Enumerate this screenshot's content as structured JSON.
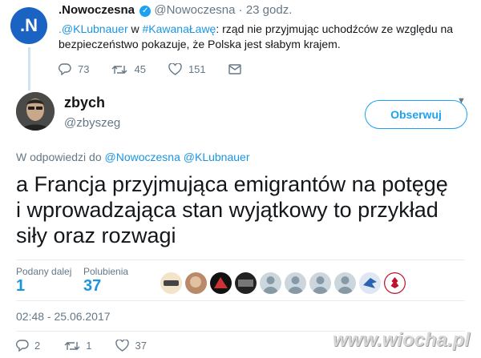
{
  "quoted_tweet": {
    "avatar_letter": ".N",
    "name": ".Nowoczesna",
    "handle": "@Nowoczesna",
    "time": "· 23 godz.",
    "reply_mention": ".@KLubnauer",
    "text_w": " w ",
    "hashtag": "#KawanaŁawę",
    "text_line1_rest": ": rząd nie przyjmując uchodźców ze względu na",
    "text_line2": "bezpieczeństwo pokazuje, że Polska jest słabym krajem.",
    "replies": "73",
    "retweets": "45",
    "likes": "151"
  },
  "tweet": {
    "name": "zbych",
    "handle": "@zbyszeg",
    "follow_label": "Obserwuj",
    "reply_prefix": "W odpowiedzi do ",
    "reply_to": "@Nowoczesna @KLubnauer",
    "text_line1": "a Francja przyjmująca emigrantów na potęgę",
    "text_line2": "i wprowadzająca stan wyjątkowy to przykład",
    "text_line3": "siły oraz rozwagi",
    "retweets_label": "Podany dalej",
    "retweets_count": "1",
    "likes_label": "Polubienia",
    "likes_count": "37",
    "timestamp": "02:48 - 25.06.2017",
    "replies": "2",
    "retweets": "1",
    "likes": "37"
  },
  "watermark": "www.wiocha.pl",
  "colors": {
    "accent": "#1da1f2",
    "link": "#1b95e0",
    "muted": "#657786",
    "like_red": "#e0245e"
  }
}
